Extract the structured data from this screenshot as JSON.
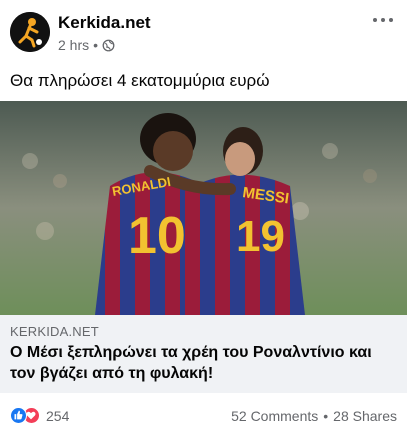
{
  "post": {
    "page_name": "Kerkida.net",
    "time": "2 hrs",
    "separator": "•",
    "caption": "Θα πληρώσει 4 εκατομμύρια ευρώ",
    "photo": {
      "jersey_text_left": "RONALDI",
      "jersey_number_left": "10",
      "jersey_text_right": "MESSI",
      "jersey_number_right": "19"
    },
    "link": {
      "domain": "KERKIDA.NET",
      "title": "Ο Μέσι ξεπληρώνει τα χρέη του Ροναλντίνιο και τον βγάζει από τη φυλακή!"
    },
    "footer": {
      "reaction_count": "254",
      "comments": "52 Comments",
      "dot": "•",
      "shares": "28 Shares"
    },
    "colors": {
      "like": "#1877f2",
      "love": "#f33e58",
      "link_bg": "#f0f2f5",
      "secondary_text": "#65676b"
    }
  }
}
